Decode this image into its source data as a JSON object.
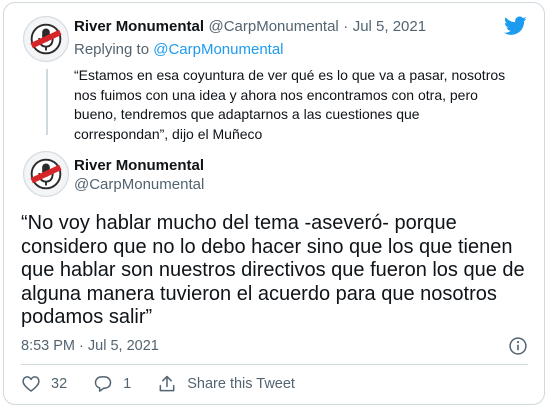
{
  "colors": {
    "accent": "#1d9bf0",
    "text": "#0f1419",
    "muted": "#536471",
    "border": "#cfd9de",
    "avatar_red": "#d7262a"
  },
  "icons": {
    "logo": "twitter-bird-icon",
    "info": "info-circle-icon",
    "like": "heart-icon",
    "reply": "speech-bubble-icon",
    "share": "share-arrow-icon"
  },
  "parent_tweet": {
    "author_name": "River Monumental",
    "handle": "@CarpMonumental",
    "separator": "·",
    "date": "Jul 5, 2021",
    "replying_prefix": "Replying to",
    "replying_handle": "@CarpMonumental",
    "text": "“Estamos en esa coyuntura de ver qué es lo que va a pasar, nosotros nos fuimos con una idea y ahora nos encontramos con otra, pero bueno, tendremos que adaptarnos a las cuestiones que correspondan”, dijo el Muñeco"
  },
  "main_tweet": {
    "author_name": "River Monumental",
    "handle": "@CarpMonumental",
    "text": "“No voy hablar mucho del tema -aseveró- porque considero que no lo debo hacer sino que los que tienen que hablar son nuestros directivos que fueron los que de alguna manera tuvieron el acuerdo para que nosotros podamos salir”",
    "time": "8:53 PM",
    "date_sep": "·",
    "date": "Jul 5, 2021"
  },
  "actions": {
    "likes": "32",
    "replies": "1",
    "share_label": "Share this Tweet"
  }
}
